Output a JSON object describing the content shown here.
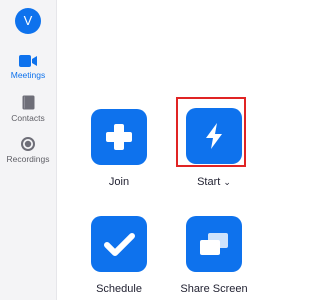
{
  "sidebar": {
    "avatar_initial": "V",
    "items": [
      {
        "label": "Meetings",
        "icon": "video-camera-icon",
        "active": true
      },
      {
        "label": "Contacts",
        "icon": "contacts-book-icon",
        "active": false
      },
      {
        "label": "Recordings",
        "icon": "record-icon",
        "active": false
      }
    ]
  },
  "actions": [
    {
      "label": "Join",
      "icon": "plus-icon"
    },
    {
      "label": "Start",
      "icon": "lightning-icon",
      "dropdown_glyph": "⌄",
      "highlighted": true
    },
    {
      "label": "Schedule",
      "icon": "checkmark-icon"
    },
    {
      "label": "Share Screen",
      "icon": "share-screen-icon"
    }
  ],
  "colors": {
    "accent": "#0e72ed",
    "sidebar_bg": "#f4f4f6",
    "highlight_border": "#e02424"
  }
}
